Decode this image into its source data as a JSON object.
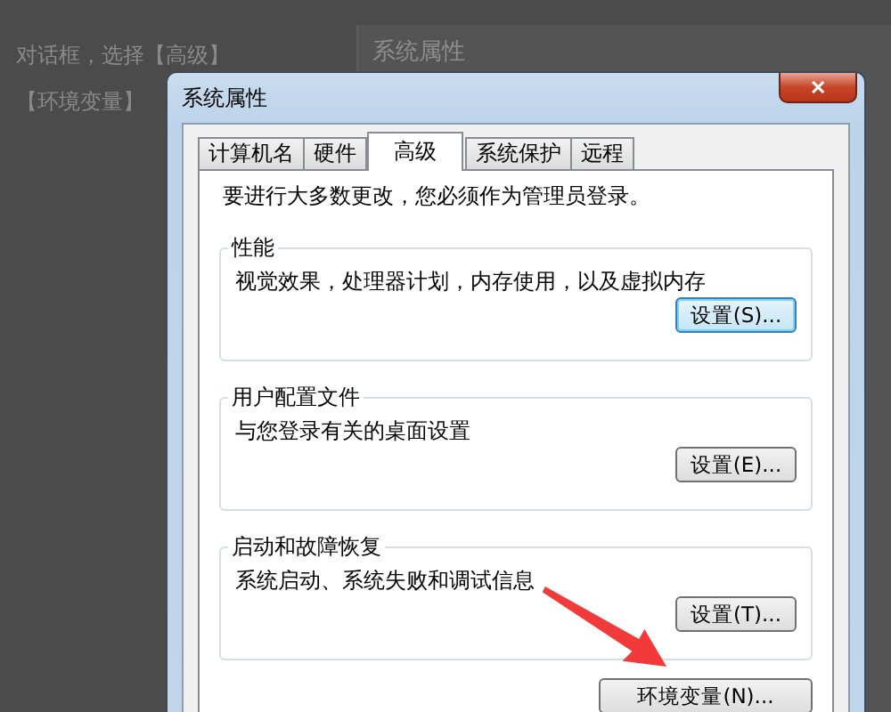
{
  "background": {
    "article_lines": [
      "对话框，选择【高级】",
      "【环境变量】"
    ],
    "window_title": "系统属性"
  },
  "dialog": {
    "title": "系统属性",
    "close": "✕",
    "tabs": [
      {
        "label": "计算机名",
        "selected": false
      },
      {
        "label": "硬件",
        "selected": false
      },
      {
        "label": "高级",
        "selected": true
      },
      {
        "label": "系统保护",
        "selected": false
      },
      {
        "label": "远程",
        "selected": false
      }
    ],
    "notice": "要进行大多数更改，您必须作为管理员登录。",
    "groups": [
      {
        "title": "性能",
        "description": "视觉效果，处理器计划，内存使用，以及虚拟内存",
        "button": "设置(S)...",
        "focused": true
      },
      {
        "title": "用户配置文件",
        "description": "与您登录有关的桌面设置",
        "button": "设置(E)...",
        "focused": false
      },
      {
        "title": "启动和故障恢复",
        "description": "系统启动、系统失败和调试信息",
        "button": "设置(T)...",
        "focused": false
      }
    ],
    "env_button": "环境变量(N)..."
  }
}
